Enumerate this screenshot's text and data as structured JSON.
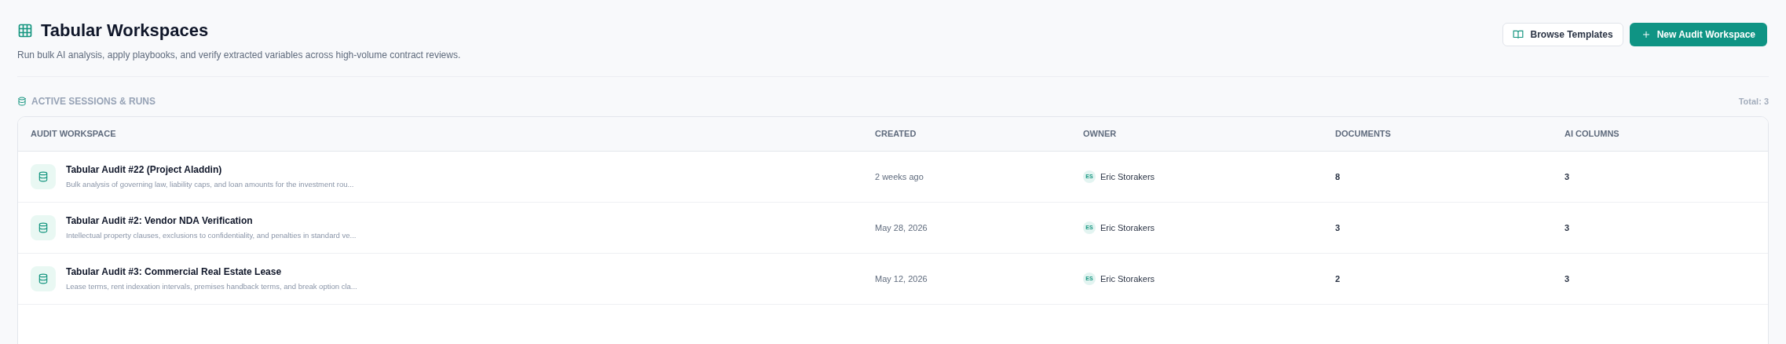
{
  "header": {
    "title": "Tabular Workspaces",
    "subtitle": "Run bulk AI analysis, apply playbooks, and verify extracted variables across high-volume contract reviews."
  },
  "actions": [
    {
      "kind": "secondary",
      "label": "Browse Templates"
    },
    {
      "kind": "primary",
      "label": "New Audit Workspace"
    }
  ],
  "section": {
    "title": "ACTIVE SESSIONS & RUNS",
    "total": "Total: 3"
  },
  "table": {
    "columns": [
      "AUDIT WORKSPACE",
      "CREATED",
      "OWNER",
      "DOCUMENTS",
      "AI COLUMNS"
    ],
    "rows": [
      {
        "name": "Tabular Audit #22 (Project Aladdin)",
        "description": "Bulk analysis of governing law, liability caps, and loan amounts for the investment rou...",
        "created": "2 weeks ago",
        "owner_initials": "ES",
        "owner": "Eric Storakers",
        "documents": "8",
        "ai_columns": "3"
      },
      {
        "name": "Tabular Audit #2: Vendor NDA Verification",
        "description": "Intellectual property clauses, exclusions to confidentiality, and penalties in standard ve...",
        "created": "May 28, 2026",
        "owner_initials": "ES",
        "owner": "Eric Storakers",
        "documents": "3",
        "ai_columns": "3"
      },
      {
        "name": "Tabular Audit #3: Commercial Real Estate Lease",
        "description": "Lease terms, rent indexation intervals, premises handback terms, and break option cla...",
        "created": "May 12, 2026",
        "owner_initials": "ES",
        "owner": "Eric Storakers",
        "documents": "2",
        "ai_columns": "3"
      }
    ]
  }
}
